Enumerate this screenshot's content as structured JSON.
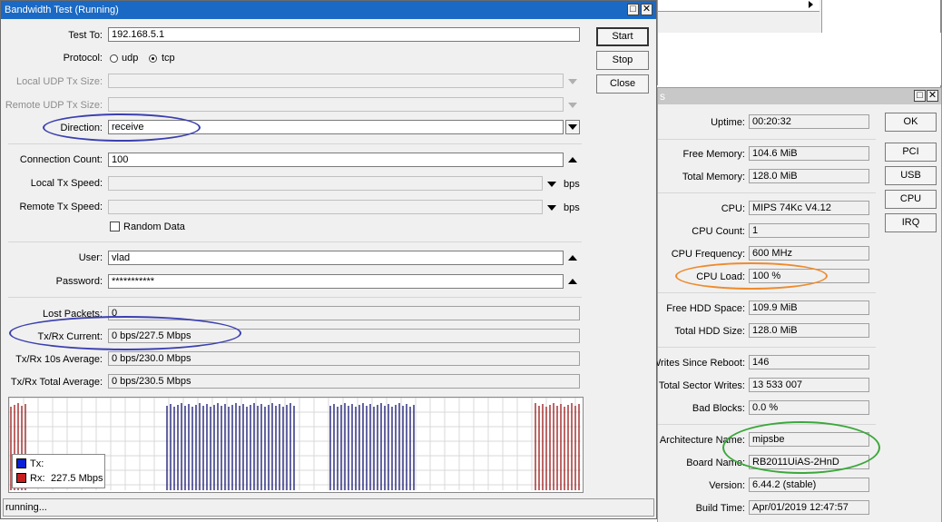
{
  "colors": {
    "title_bar": "#1a69c4",
    "tx": "#0a1fd6",
    "rx": "#c81e1e",
    "tx_bars": "#23237a",
    "rx_bars": "#a12626",
    "annot_blue": "#3b3fb0",
    "annot_orange": "#ef8a2c",
    "annot_green": "#3aa83a"
  },
  "bandwidth": {
    "title": "Bandwidth Test (Running)",
    "test_to_label": "Test To:",
    "test_to_value": "192.168.5.1",
    "protocol_label": "Protocol:",
    "protocol_udp": "udp",
    "protocol_tcp": "tcp",
    "protocol_selected": "tcp",
    "local_udp_label": "Local UDP Tx Size:",
    "local_udp_value": "",
    "remote_udp_label": "Remote UDP Tx Size:",
    "remote_udp_value": "",
    "direction_label": "Direction:",
    "direction_value": "receive",
    "conn_count_label": "Connection Count:",
    "conn_count_value": "100",
    "local_tx_label": "Local Tx Speed:",
    "local_tx_value": "",
    "local_tx_unit": "bps",
    "remote_tx_label": "Remote Tx Speed:",
    "remote_tx_value": "",
    "remote_tx_unit": "bps",
    "random_data_label": "Random Data",
    "user_label": "User:",
    "user_value": "vlad",
    "password_label": "Password:",
    "password_value": "***********",
    "lost_packets_label": "Lost Packets:",
    "lost_packets_value": "0",
    "txrx_current_label": "Tx/Rx Current:",
    "txrx_current_value": "0 bps/227.5 Mbps",
    "txrx_10s_label": "Tx/Rx 10s Average:",
    "txrx_10s_value": "0 bps/230.0 Mbps",
    "txrx_total_label": "Tx/Rx Total Average:",
    "txrx_total_value": "0 bps/230.5 Mbps",
    "start_label": "Start",
    "stop_label": "Stop",
    "close_label": "Close",
    "legend_tx": "Tx:",
    "legend_rx": "Rx:",
    "legend_rx_value": "227.5 Mbps",
    "status": "running..."
  },
  "resources": {
    "title_fragment": "s",
    "uptime_label": "Uptime:",
    "uptime_value": "00:20:32",
    "free_mem_label": "Free Memory:",
    "free_mem_value": "104.6 MiB",
    "total_mem_label": "Total Memory:",
    "total_mem_value": "128.0 MiB",
    "cpu_label": "CPU:",
    "cpu_value": "MIPS 74Kc V4.12",
    "cpu_count_label": "CPU Count:",
    "cpu_count_value": "1",
    "cpu_freq_label": "CPU Frequency:",
    "cpu_freq_value": "600 MHz",
    "cpu_load_label": "CPU Load:",
    "cpu_load_value": "100 %",
    "free_hdd_label": "Free HDD Space:",
    "free_hdd_value": "109.9 MiB",
    "total_hdd_label": "Total HDD Size:",
    "total_hdd_value": "128.0 MiB",
    "writes_label": "Writes Since Reboot:",
    "writes_value": "146",
    "total_sector_label": "Total Sector Writes:",
    "total_sector_value": "13 533 007",
    "bad_blocks_label": "Bad Blocks:",
    "bad_blocks_value": "0.0 %",
    "arch_label": "Architecture Name:",
    "arch_value": "mipsbe",
    "board_label": "Board Name:",
    "board_value": "RB2011UiAS-2HnD",
    "version_label": "Version:",
    "version_value": "6.44.2 (stable)",
    "build_label": "Build Time:",
    "build_value": "Apr/01/2019 12:47:57",
    "ok_label": "OK",
    "pci_label": "PCI",
    "usb_label": "USB",
    "cpu_btn_label": "CPU",
    "irq_label": "IRQ"
  },
  "chart_data": {
    "type": "bar",
    "series": [
      {
        "name": "Tx",
        "color": "#0a1fd6",
        "values": []
      },
      {
        "name": "Rx",
        "color": "#c81e1e",
        "values_mbps": [
          227.5
        ]
      }
    ],
    "grid": true
  }
}
